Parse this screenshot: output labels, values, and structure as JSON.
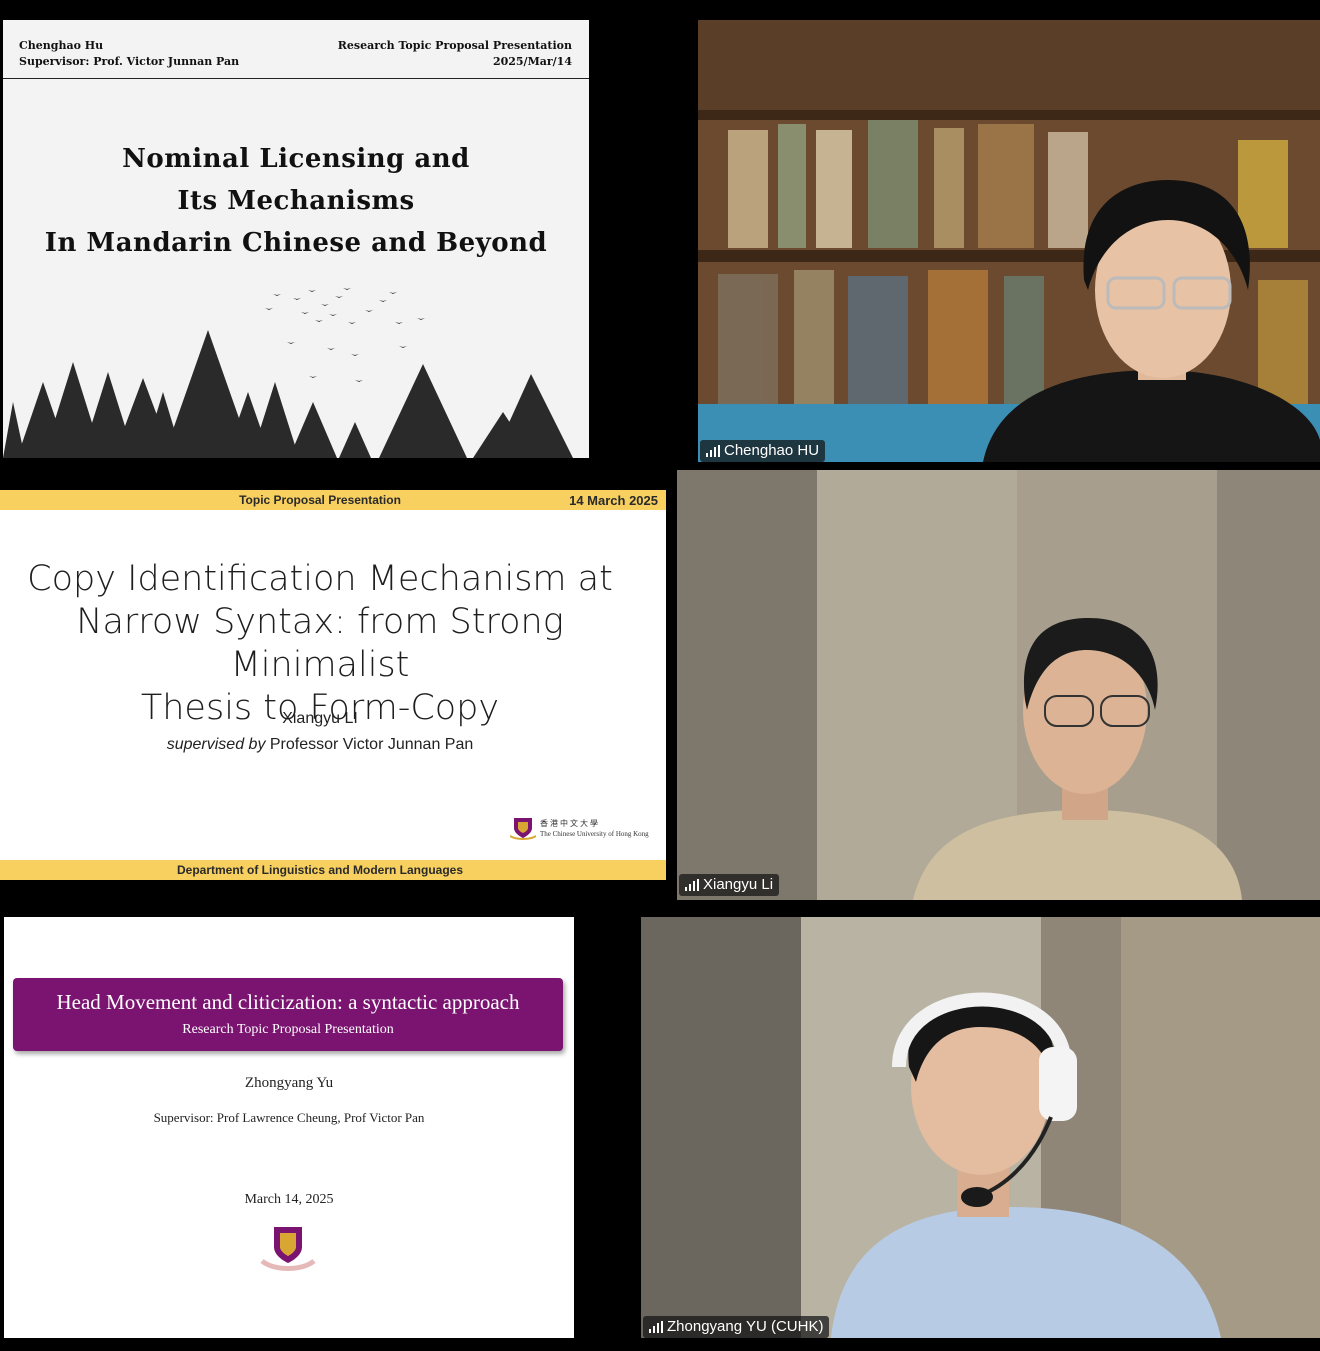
{
  "slide1": {
    "header_left_line1": "Chenghao Hu",
    "header_left_line2": "Supervisor: Prof. Victor Junnan Pan",
    "header_right_line1": "Research Topic Proposal Presentation",
    "header_right_line2": "2025/Mar/14",
    "title_line1": "Nominal Licensing and",
    "title_line2": "Its Mechanisms",
    "title_line3": "In Mandarin Chinese and Beyond"
  },
  "slide2": {
    "top_center": "Topic Proposal Presentation",
    "top_right": "14 March 2025",
    "title_line1": "Copy Identification Mechanism at",
    "title_line2": "Narrow Syntax: from Strong Minimalist",
    "title_line3": "Thesis to Form-Copy",
    "author": "Xiangyu LI",
    "supervised_by": "supervised by",
    "supervisor": " Professor Victor Junnan Pan",
    "logo_zh": "香港中文大學",
    "logo_en": "The Chinese University of Hong Kong",
    "bottom_center": "Department of Linguistics and Modern Languages"
  },
  "slide3": {
    "title": "Head Movement and cliticization: a syntactic approach",
    "subtitle": "Research Topic Proposal Presentation",
    "author": "Zhongyang Yu",
    "supervisors": "Supervisor: Prof Lawrence Cheung, Prof Victor Pan",
    "date": "March 14, 2025"
  },
  "participants": [
    {
      "name": "Chenghao HU"
    },
    {
      "name": "Xiangyu Li"
    },
    {
      "name": "Zhongyang YU (CUHK)"
    }
  ],
  "colors": {
    "slide2_bar": "#f7d060",
    "slide3_box": "#7a1470"
  }
}
